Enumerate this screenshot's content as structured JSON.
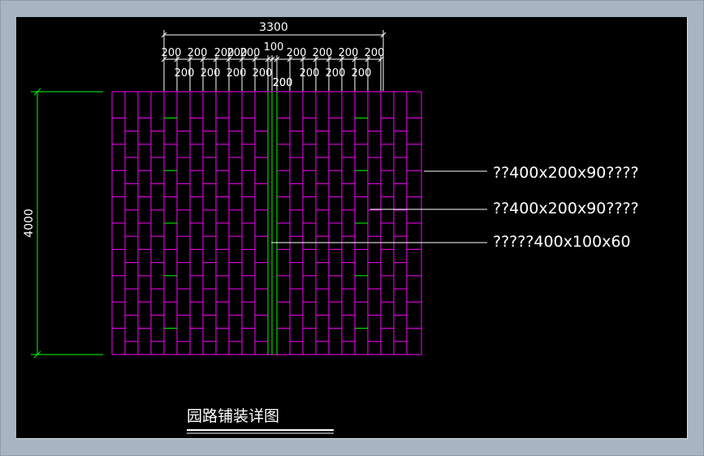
{
  "drawing": {
    "title": "园路铺装详图",
    "width_dim": "3300",
    "height_dim": "4000",
    "upper_dims": [
      "200",
      "200",
      "200",
      "200",
      "200",
      "100",
      "200",
      "200",
      "200",
      "200"
    ],
    "lower_dims": [
      "200",
      "200",
      "200",
      "200",
      "200",
      "200",
      "200",
      "200",
      "200"
    ],
    "leaders": [
      "??400x200x90????",
      "??400x200x90????",
      "?????400x100x60"
    ]
  },
  "colors": {
    "background": "#000000",
    "paver": "#ff00ff",
    "accent_paver": "#00ff00",
    "dimension": "#ffffff",
    "height_dimension": "#00ff00"
  }
}
